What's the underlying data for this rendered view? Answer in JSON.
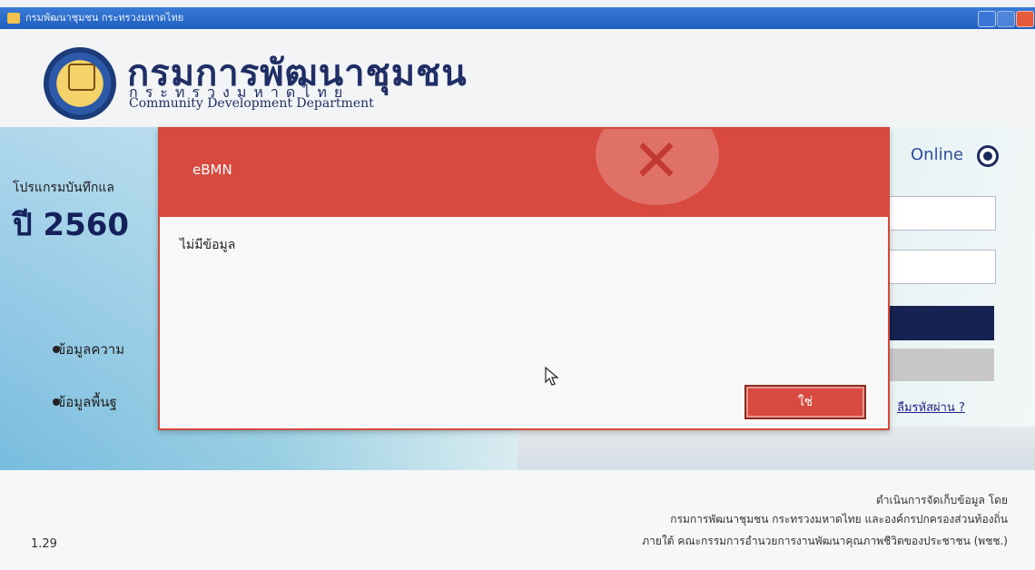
{
  "window": {
    "title": "กรมพัฒนาชุมชน กระทรวงมหาดไทย"
  },
  "header": {
    "org_thai": "กรมการพัฒนาชุมชน",
    "org_ministry": "กระทรวงมหาดไทย",
    "org_english": "Community Development Department"
  },
  "main": {
    "program_label": "โปรแกรมบันทึกแล",
    "year_label": "ปี 2560",
    "bullets": [
      "ข้อมูลความ",
      "ข้อมูลพื้นฐ"
    ],
    "status": "Online",
    "forgot_password": "ลืมรหัสผ่าน ?"
  },
  "dialog": {
    "title": "eBMN",
    "message": "ไม่มีข้อมูล",
    "ok_label": "ใช่",
    "accent": "#d8493f"
  },
  "footer": {
    "line1": "ดำเนินการจัดเก็บข้อมูล โดย",
    "line2": "กรมการพัฒนาชุมชน กระทรวงมหาดไทย และองค์กรปกครองส่วนท้องถิ่น",
    "line3": "ภายใต้ คณะกรรมการอำนวยการงานพัฒนาคุณภาพชีวิตของประชาชน (พชช.)",
    "version": "1.29"
  }
}
